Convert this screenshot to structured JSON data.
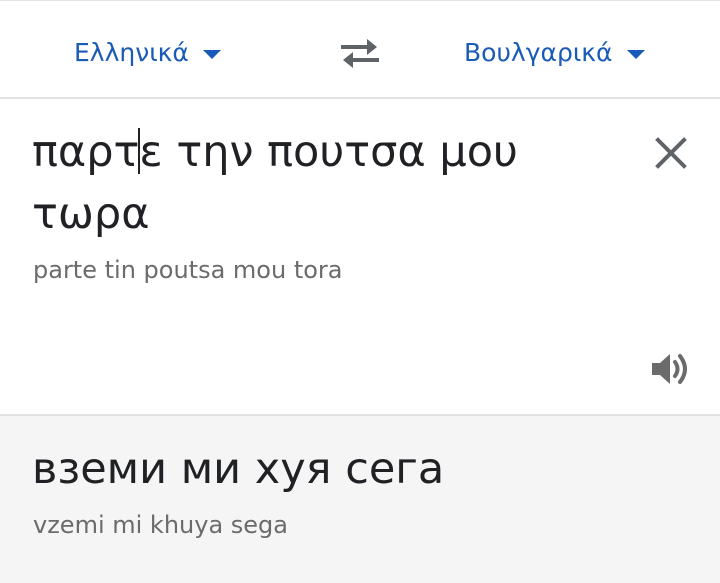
{
  "language_bar": {
    "source_language": "Ελληνικά",
    "target_language": "Βουλγαρικά",
    "accent_color": "#1a5bb8",
    "swap_icon": "swap-arrows-icon"
  },
  "source": {
    "text_before_cursor": "παρτ",
    "text_after_cursor": "ε την πουτσα μου τωρα",
    "transliteration": "parte tin poutsa mou tora",
    "clear_icon": "close-icon",
    "listen_icon": "speaker-icon"
  },
  "result": {
    "text": "вземи ми хуя сега",
    "transliteration": "vzemi mi khuya sega"
  }
}
